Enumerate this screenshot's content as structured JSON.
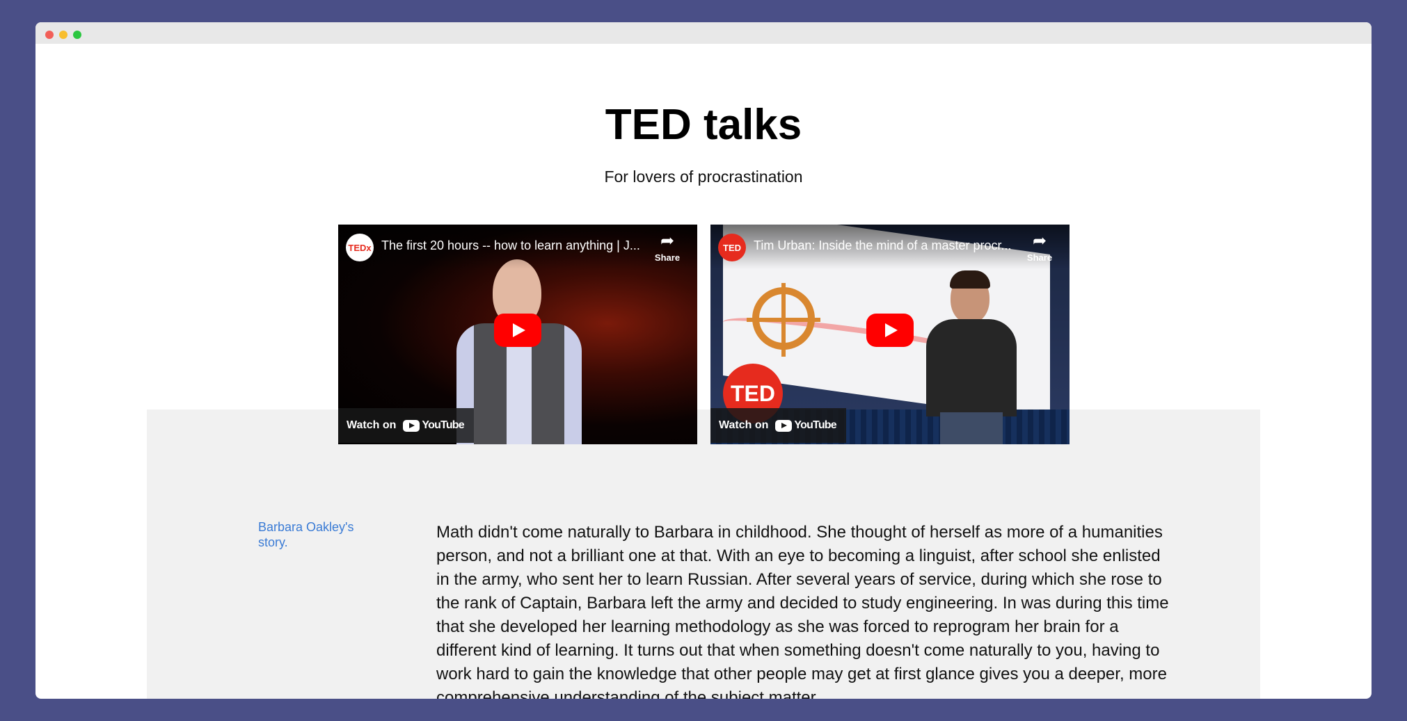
{
  "page": {
    "title": "TED talks",
    "subtitle": "For lovers of procrastination"
  },
  "videos": [
    {
      "channel": "TEDx",
      "title": "The first 20 hours -- how to learn anything | J...",
      "share_label": "Share",
      "watch_label": "Watch on",
      "youtube_label": "YouTube"
    },
    {
      "channel": "TED",
      "title": "Tim Urban: Inside the mind of a master procr...",
      "share_label": "Share",
      "watch_label": "Watch on",
      "youtube_label": "YouTube",
      "stage_logo": "TED"
    }
  ],
  "story": {
    "label": "Barbara Oakley's story.",
    "text": "Math didn't come naturally to Barbara in childhood. She thought of herself as more of a humanities person, and not a brilliant one at that. With an eye to becoming a linguist, after school she enlisted in the army, who sent her to learn Russian. After several years of service, during which she rose to the rank of Captain, Barbara left the army and decided to study engineering. In was during this time that she developed her learning methodology as she was forced to reprogram her brain for a different kind of learning. It turns out that when something doesn't come naturally to you, having to work hard to gain the knowledge that other people may get at first glance gives you a deeper, more comprehensive understanding of the subject matter."
  },
  "colors": {
    "background": "#4a4f87",
    "link": "#3a7bd5",
    "youtube_red": "#ff0000",
    "ted_red": "#e62b1e"
  }
}
